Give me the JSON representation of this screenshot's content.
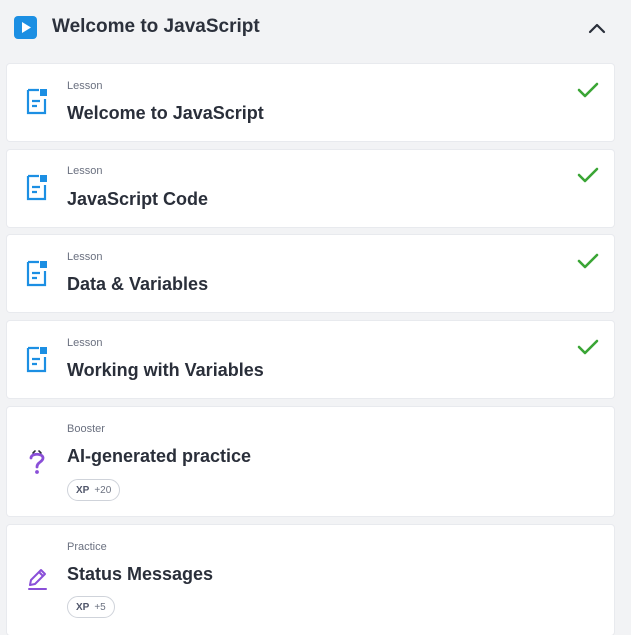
{
  "module": {
    "title": "Welcome to JavaScript",
    "accent_color": "#1c8fe3",
    "play_icon": "play-icon",
    "collapse_icon": "chevron-up-icon"
  },
  "items": [
    {
      "kind": "Lesson",
      "title": "Welcome to JavaScript",
      "icon": "lesson-document-icon",
      "completed": true
    },
    {
      "kind": "Lesson",
      "title": "JavaScript Code",
      "icon": "lesson-document-icon",
      "completed": true
    },
    {
      "kind": "Lesson",
      "title": "Data & Variables",
      "icon": "lesson-document-icon",
      "completed": true
    },
    {
      "kind": "Lesson",
      "title": "Working with Variables",
      "icon": "lesson-document-icon",
      "completed": true
    },
    {
      "kind": "Booster",
      "title": "AI-generated practice",
      "icon": "question-mark-icon",
      "xp_label": "XP",
      "xp_value": "+20"
    },
    {
      "kind": "Practice",
      "title": "Status Messages",
      "icon": "pencil-icon",
      "xp_label": "XP",
      "xp_value": "+5"
    }
  ],
  "colors": {
    "lesson_icon": "#1c8fe3",
    "practice_icon": "#8a4fd8",
    "check": "#3aa535"
  }
}
